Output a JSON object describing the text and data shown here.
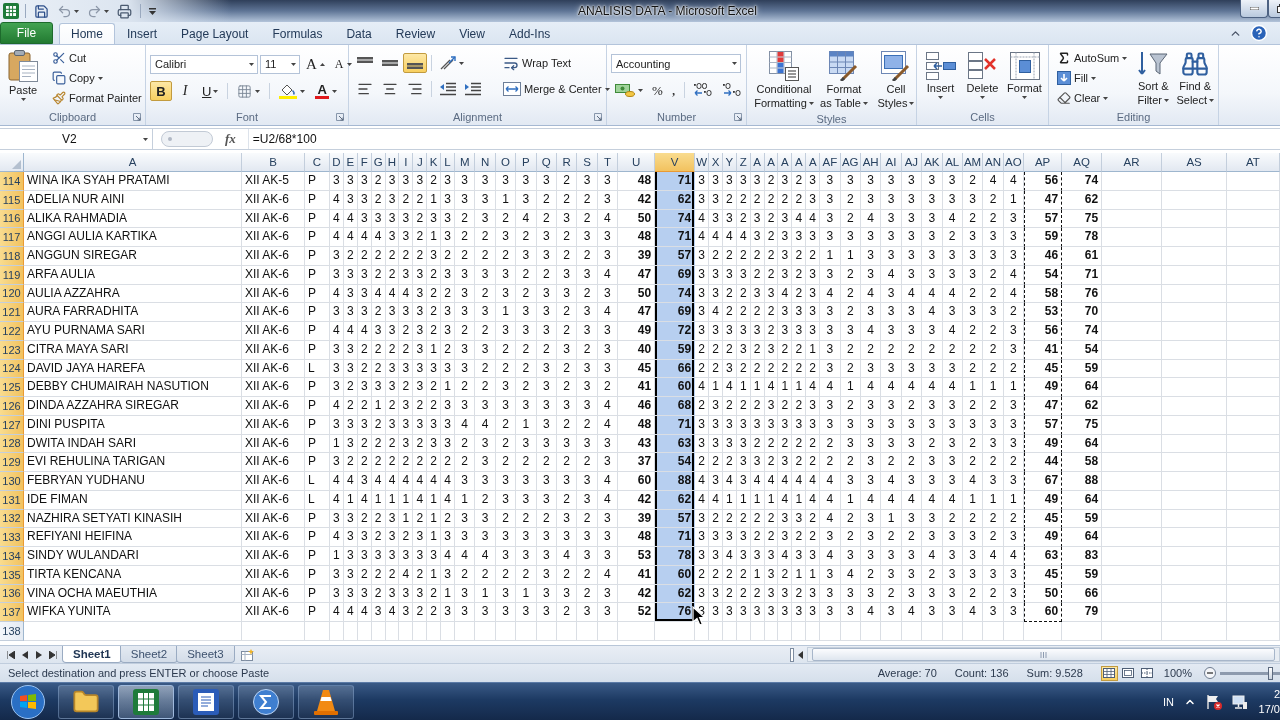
{
  "window": {
    "title": "ANALISIS DATA - Microsoft Excel"
  },
  "tabs": [
    {
      "label": "File",
      "kind": "file",
      "selected": false
    },
    {
      "label": "Home",
      "kind": "tab",
      "selected": true
    },
    {
      "label": "Insert",
      "kind": "tab",
      "selected": false
    },
    {
      "label": "Page Layout",
      "kind": "tab",
      "selected": false
    },
    {
      "label": "Formulas",
      "kind": "tab",
      "selected": false
    },
    {
      "label": "Data",
      "kind": "tab",
      "selected": false
    },
    {
      "label": "Review",
      "kind": "tab",
      "selected": false
    },
    {
      "label": "View",
      "kind": "tab",
      "selected": false
    },
    {
      "label": "Add-Ins",
      "kind": "tab",
      "selected": false
    }
  ],
  "ribbon": {
    "clipboard": {
      "label": "Clipboard",
      "paste": "Paste",
      "actions": [
        {
          "kind": "cut",
          "label": "Cut",
          "dropdown": false
        },
        {
          "kind": "copy",
          "label": "Copy",
          "dropdown": true
        },
        {
          "kind": "painter",
          "label": "Format Painter",
          "dropdown": false
        }
      ]
    },
    "font": {
      "label": "Font",
      "name": "Calibri",
      "size": "11",
      "grow": "A",
      "shrink": "A",
      "styles": [
        {
          "kind": "bold",
          "label": "B",
          "selected": true,
          "dropdown": false
        },
        {
          "kind": "italic",
          "label": "I",
          "selected": false,
          "dropdown": false
        },
        {
          "kind": "underline",
          "label": "U",
          "selected": false,
          "dropdown": true
        }
      ],
      "color_letter": "A"
    },
    "alignment": {
      "label": "Alignment",
      "vertical": [
        {
          "kind": "top",
          "selected": false
        },
        {
          "kind": "middle",
          "selected": false
        },
        {
          "kind": "bottom",
          "selected": true
        }
      ],
      "horizontal": [
        {
          "kind": "left",
          "selected": false
        },
        {
          "kind": "center",
          "selected": false
        },
        {
          "kind": "right",
          "selected": false
        }
      ],
      "wrap": "Wrap Text",
      "merge": "Merge & Center"
    },
    "number": {
      "label": "Number",
      "format": "Accounting",
      "percent": "%",
      "comma": ","
    },
    "styles": {
      "label": "Styles",
      "buttons": [
        {
          "kind": "conditional",
          "lines": [
            "Conditional",
            "Formatting"
          ]
        },
        {
          "kind": "table",
          "lines": [
            "Format",
            "as Table"
          ]
        },
        {
          "kind": "cell_styles",
          "lines": [
            "Cell",
            "Styles"
          ]
        }
      ]
    },
    "cells": {
      "label": "Cells",
      "buttons": [
        {
          "kind": "insert",
          "label": "Insert"
        },
        {
          "kind": "delete",
          "label": "Delete"
        },
        {
          "kind": "format",
          "label": "Format"
        }
      ]
    },
    "editing": {
      "label": "Editing",
      "small": [
        {
          "kind": "autosum",
          "label": "AutoSum"
        },
        {
          "kind": "fill",
          "label": "Fill"
        },
        {
          "kind": "clear",
          "label": "Clear"
        }
      ],
      "large": [
        {
          "kind": "sort",
          "lines": [
            "Sort &",
            "Filter"
          ]
        },
        {
          "kind": "find",
          "lines": [
            "Find &",
            "Select"
          ]
        }
      ]
    }
  },
  "formula_bar": {
    "name_box": "V2",
    "fx": "fx",
    "formula": "=U2/68*100"
  },
  "sheet": {
    "columns": [
      {
        "label": "A",
        "kind": "text",
        "selected": false,
        "copied": false
      },
      {
        "label": "B",
        "kind": "text",
        "selected": false,
        "copied": false
      },
      {
        "label": "C",
        "kind": "text",
        "selected": false,
        "copied": false
      },
      {
        "label": "D",
        "kind": "digit",
        "selected": false,
        "copied": false
      },
      {
        "label": "E",
        "kind": "digit",
        "selected": false,
        "copied": false
      },
      {
        "label": "F",
        "kind": "digit",
        "selected": false,
        "copied": false
      },
      {
        "label": "G",
        "kind": "digit",
        "selected": false,
        "copied": false
      },
      {
        "label": "H",
        "kind": "digit",
        "selected": false,
        "copied": false
      },
      {
        "label": "I",
        "kind": "digit",
        "selected": false,
        "copied": false
      },
      {
        "label": "J",
        "kind": "digit",
        "selected": false,
        "copied": false
      },
      {
        "label": "K",
        "kind": "digit",
        "selected": false,
        "copied": false
      },
      {
        "label": "L",
        "kind": "digit",
        "selected": false,
        "copied": false
      },
      {
        "label": "M",
        "kind": "digit",
        "selected": false,
        "copied": false
      },
      {
        "label": "N",
        "kind": "digit",
        "selected": false,
        "copied": false
      },
      {
        "label": "O",
        "kind": "digit",
        "selected": false,
        "copied": false
      },
      {
        "label": "P",
        "kind": "digit",
        "selected": false,
        "copied": false
      },
      {
        "label": "Q",
        "kind": "digit",
        "selected": false,
        "copied": false
      },
      {
        "label": "R",
        "kind": "digit",
        "selected": false,
        "copied": false
      },
      {
        "label": "S",
        "kind": "digit",
        "selected": false,
        "copied": false
      },
      {
        "label": "T",
        "kind": "digit",
        "selected": false,
        "copied": false
      },
      {
        "label": "U",
        "kind": "total",
        "selected": false,
        "copied": false
      },
      {
        "label": "V",
        "kind": "total",
        "selected": true,
        "copied": false
      },
      {
        "label": "W",
        "kind": "digit",
        "selected": false,
        "copied": false
      },
      {
        "label": "X",
        "kind": "digit",
        "selected": false,
        "copied": false
      },
      {
        "label": "Y",
        "kind": "digit",
        "selected": false,
        "copied": false
      },
      {
        "label": "Z",
        "kind": "digit",
        "selected": false,
        "copied": false
      },
      {
        "label": "A",
        "kind": "digit",
        "selected": false,
        "copied": false
      },
      {
        "label": "A",
        "kind": "digit",
        "selected": false,
        "copied": false
      },
      {
        "label": "A",
        "kind": "digit",
        "selected": false,
        "copied": false
      },
      {
        "label": "A",
        "kind": "digit",
        "selected": false,
        "copied": false
      },
      {
        "label": "A",
        "kind": "digit",
        "selected": false,
        "copied": false
      },
      {
        "label": "AF",
        "kind": "digit",
        "selected": false,
        "copied": false
      },
      {
        "label": "AG",
        "kind": "digit",
        "selected": false,
        "copied": false
      },
      {
        "label": "AH",
        "kind": "digit",
        "selected": false,
        "copied": false
      },
      {
        "label": "AI",
        "kind": "digit",
        "selected": false,
        "copied": false
      },
      {
        "label": "AJ",
        "kind": "digit",
        "selected": false,
        "copied": false
      },
      {
        "label": "AK",
        "kind": "digit",
        "selected": false,
        "copied": false
      },
      {
        "label": "AL",
        "kind": "digit",
        "selected": false,
        "copied": false
      },
      {
        "label": "AM",
        "kind": "digit",
        "selected": false,
        "copied": false
      },
      {
        "label": "AN",
        "kind": "digit",
        "selected": false,
        "copied": false
      },
      {
        "label": "AO",
        "kind": "digit",
        "selected": false,
        "copied": false
      },
      {
        "label": "AP",
        "kind": "total",
        "selected": false,
        "copied": true
      },
      {
        "label": "AQ",
        "kind": "total",
        "selected": false,
        "copied": false
      },
      {
        "label": "AR",
        "kind": "blank",
        "selected": false,
        "copied": false
      },
      {
        "label": "AS",
        "kind": "blank",
        "selected": false,
        "copied": false
      },
      {
        "label": "AT",
        "kind": "blank",
        "selected": false,
        "copied": false
      }
    ],
    "rows": [
      {
        "number": "114",
        "selected": true,
        "cells": [
          "WINA IKA SYAH PRATAMI",
          "XII AK-5",
          "P",
          "3",
          "3",
          "3",
          "2",
          "3",
          "3",
          "3",
          "2",
          "3",
          "3",
          "3",
          "3",
          "3",
          "3",
          "2",
          "3",
          "3",
          "48",
          "71",
          "3",
          "3",
          "3",
          "3",
          "3",
          "2",
          "3",
          "2",
          "3",
          "3",
          "3",
          "3",
          "3",
          "3",
          "3",
          "3",
          "2",
          "4",
          "4",
          "56",
          "74"
        ]
      },
      {
        "number": "115",
        "selected": true,
        "cells": [
          "ADELIA NUR AINI",
          "XII AK-6",
          "P",
          "4",
          "3",
          "3",
          "2",
          "3",
          "2",
          "2",
          "1",
          "3",
          "3",
          "3",
          "1",
          "3",
          "2",
          "2",
          "2",
          "3",
          "42",
          "62",
          "3",
          "3",
          "2",
          "2",
          "2",
          "2",
          "2",
          "2",
          "3",
          "3",
          "2",
          "3",
          "3",
          "3",
          "3",
          "3",
          "3",
          "2",
          "1",
          "47",
          "62"
        ]
      },
      {
        "number": "116",
        "selected": true,
        "cells": [
          "ALIKA RAHMADIA",
          "XII AK-6",
          "P",
          "4",
          "4",
          "3",
          "3",
          "3",
          "3",
          "2",
          "3",
          "3",
          "2",
          "3",
          "2",
          "4",
          "2",
          "3",
          "2",
          "4",
          "50",
          "74",
          "4",
          "3",
          "3",
          "2",
          "3",
          "2",
          "3",
          "4",
          "4",
          "3",
          "2",
          "4",
          "3",
          "3",
          "3",
          "4",
          "2",
          "2",
          "3",
          "57",
          "75"
        ]
      },
      {
        "number": "117",
        "selected": true,
        "cells": [
          "ANGGI AULIA KARTIKA",
          "XII AK-6",
          "P",
          "4",
          "4",
          "4",
          "4",
          "3",
          "3",
          "2",
          "1",
          "3",
          "2",
          "2",
          "3",
          "2",
          "3",
          "2",
          "3",
          "3",
          "48",
          "71",
          "4",
          "4",
          "4",
          "4",
          "3",
          "2",
          "3",
          "3",
          "3",
          "3",
          "3",
          "3",
          "3",
          "3",
          "3",
          "2",
          "3",
          "3",
          "3",
          "59",
          "78"
        ]
      },
      {
        "number": "118",
        "selected": true,
        "cells": [
          "ANGGUN SIREGAR",
          "XII AK-6",
          "P",
          "3",
          "2",
          "2",
          "2",
          "2",
          "2",
          "2",
          "3",
          "2",
          "2",
          "2",
          "2",
          "3",
          "3",
          "2",
          "2",
          "3",
          "39",
          "57",
          "3",
          "2",
          "2",
          "2",
          "2",
          "2",
          "3",
          "2",
          "2",
          "1",
          "1",
          "3",
          "3",
          "3",
          "3",
          "3",
          "3",
          "3",
          "3",
          "46",
          "61"
        ]
      },
      {
        "number": "119",
        "selected": true,
        "cells": [
          "ARFA AULIA",
          "XII AK-6",
          "P",
          "3",
          "3",
          "3",
          "2",
          "2",
          "3",
          "3",
          "2",
          "3",
          "3",
          "3",
          "3",
          "2",
          "2",
          "3",
          "3",
          "4",
          "47",
          "69",
          "3",
          "3",
          "3",
          "3",
          "2",
          "2",
          "3",
          "2",
          "3",
          "3",
          "2",
          "3",
          "4",
          "3",
          "3",
          "3",
          "3",
          "2",
          "4",
          "54",
          "71"
        ]
      },
      {
        "number": "120",
        "selected": true,
        "cells": [
          "AULIA AZZAHRA",
          "XII AK-6",
          "P",
          "4",
          "3",
          "3",
          "4",
          "4",
          "4",
          "3",
          "2",
          "2",
          "3",
          "2",
          "3",
          "2",
          "3",
          "3",
          "2",
          "3",
          "50",
          "74",
          "3",
          "3",
          "2",
          "2",
          "3",
          "3",
          "4",
          "2",
          "3",
          "4",
          "2",
          "4",
          "3",
          "4",
          "4",
          "4",
          "2",
          "2",
          "4",
          "58",
          "76"
        ]
      },
      {
        "number": "121",
        "selected": true,
        "cells": [
          "AURA FARRADHITA",
          "XII AK-6",
          "P",
          "3",
          "3",
          "3",
          "2",
          "3",
          "3",
          "3",
          "2",
          "3",
          "3",
          "3",
          "1",
          "3",
          "3",
          "2",
          "3",
          "4",
          "47",
          "69",
          "3",
          "4",
          "2",
          "2",
          "2",
          "2",
          "3",
          "3",
          "3",
          "3",
          "2",
          "3",
          "3",
          "3",
          "4",
          "3",
          "3",
          "3",
          "2",
          "53",
          "70"
        ]
      },
      {
        "number": "122",
        "selected": true,
        "cells": [
          "AYU PURNAMA SARI",
          "XII AK-6",
          "P",
          "4",
          "4",
          "4",
          "3",
          "3",
          "2",
          "3",
          "2",
          "3",
          "2",
          "2",
          "3",
          "3",
          "3",
          "2",
          "3",
          "3",
          "49",
          "72",
          "3",
          "3",
          "3",
          "3",
          "3",
          "2",
          "3",
          "3",
          "3",
          "3",
          "3",
          "4",
          "3",
          "3",
          "3",
          "4",
          "2",
          "2",
          "3",
          "56",
          "74"
        ]
      },
      {
        "number": "123",
        "selected": true,
        "cells": [
          "CITRA MAYA SARI",
          "XII AK-6",
          "P",
          "3",
          "3",
          "2",
          "2",
          "2",
          "2",
          "3",
          "1",
          "2",
          "3",
          "3",
          "2",
          "2",
          "2",
          "3",
          "2",
          "3",
          "40",
          "59",
          "2",
          "2",
          "2",
          "3",
          "2",
          "3",
          "2",
          "2",
          "1",
          "3",
          "2",
          "2",
          "2",
          "2",
          "2",
          "2",
          "2",
          "2",
          "3",
          "41",
          "54"
        ]
      },
      {
        "number": "124",
        "selected": true,
        "cells": [
          "DAVID JAYA HAREFA",
          "XII AK-6",
          "L",
          "3",
          "3",
          "2",
          "2",
          "3",
          "3",
          "3",
          "3",
          "3",
          "3",
          "2",
          "2",
          "2",
          "3",
          "2",
          "3",
          "3",
          "45",
          "66",
          "2",
          "2",
          "3",
          "2",
          "2",
          "2",
          "2",
          "2",
          "2",
          "3",
          "2",
          "3",
          "3",
          "3",
          "3",
          "3",
          "2",
          "2",
          "2",
          "45",
          "59"
        ]
      },
      {
        "number": "125",
        "selected": true,
        "cells": [
          "DEBBY CHUMAIRAH NASUTION",
          "XII AK-6",
          "P",
          "3",
          "2",
          "3",
          "3",
          "3",
          "2",
          "3",
          "2",
          "1",
          "2",
          "2",
          "3",
          "2",
          "3",
          "2",
          "3",
          "2",
          "41",
          "60",
          "4",
          "1",
          "4",
          "1",
          "1",
          "4",
          "1",
          "1",
          "4",
          "4",
          "1",
          "4",
          "4",
          "4",
          "4",
          "4",
          "1",
          "1",
          "1",
          "49",
          "64"
        ]
      },
      {
        "number": "126",
        "selected": true,
        "cells": [
          "DINDA AZZAHRA SIREGAR",
          "XII AK-6",
          "P",
          "4",
          "2",
          "2",
          "1",
          "2",
          "3",
          "2",
          "2",
          "3",
          "3",
          "3",
          "3",
          "3",
          "3",
          "3",
          "3",
          "4",
          "46",
          "68",
          "2",
          "3",
          "2",
          "2",
          "2",
          "3",
          "2",
          "2",
          "3",
          "3",
          "2",
          "3",
          "3",
          "2",
          "3",
          "3",
          "2",
          "2",
          "3",
          "47",
          "62"
        ]
      },
      {
        "number": "127",
        "selected": true,
        "cells": [
          "DINI PUSPITA",
          "XII AK-6",
          "P",
          "3",
          "3",
          "3",
          "2",
          "3",
          "3",
          "3",
          "3",
          "3",
          "4",
          "4",
          "2",
          "1",
          "3",
          "2",
          "2",
          "4",
          "48",
          "71",
          "3",
          "3",
          "3",
          "3",
          "3",
          "3",
          "3",
          "3",
          "3",
          "3",
          "3",
          "3",
          "3",
          "3",
          "3",
          "3",
          "3",
          "3",
          "3",
          "57",
          "75"
        ]
      },
      {
        "number": "128",
        "selected": true,
        "cells": [
          "DWITA INDAH SARI",
          "XII AK-6",
          "P",
          "1",
          "3",
          "2",
          "2",
          "2",
          "3",
          "2",
          "3",
          "3",
          "2",
          "3",
          "2",
          "3",
          "3",
          "3",
          "3",
          "3",
          "43",
          "63",
          "3",
          "3",
          "3",
          "3",
          "2",
          "2",
          "2",
          "2",
          "2",
          "2",
          "3",
          "3",
          "3",
          "3",
          "2",
          "3",
          "2",
          "3",
          "3",
          "49",
          "64"
        ]
      },
      {
        "number": "129",
        "selected": true,
        "cells": [
          "EVI REHULINA TARIGAN",
          "XII AK-6",
          "P",
          "3",
          "2",
          "2",
          "2",
          "2",
          "2",
          "2",
          "2",
          "2",
          "2",
          "3",
          "2",
          "2",
          "2",
          "2",
          "2",
          "3",
          "37",
          "54",
          "2",
          "2",
          "2",
          "3",
          "3",
          "2",
          "3",
          "2",
          "2",
          "2",
          "2",
          "3",
          "2",
          "2",
          "3",
          "3",
          "2",
          "2",
          "2",
          "44",
          "58"
        ]
      },
      {
        "number": "130",
        "selected": true,
        "cells": [
          "FEBRYAN YUDHANU",
          "XII AK-6",
          "L",
          "4",
          "4",
          "3",
          "4",
          "4",
          "4",
          "4",
          "4",
          "4",
          "3",
          "3",
          "3",
          "3",
          "3",
          "3",
          "3",
          "4",
          "60",
          "88",
          "4",
          "3",
          "4",
          "3",
          "4",
          "4",
          "4",
          "4",
          "4",
          "4",
          "3",
          "3",
          "4",
          "3",
          "3",
          "3",
          "4",
          "3",
          "3",
          "67",
          "88"
        ]
      },
      {
        "number": "131",
        "selected": true,
        "cells": [
          "IDE FIMAN",
          "XII AK-6",
          "L",
          "4",
          "1",
          "4",
          "1",
          "1",
          "1",
          "4",
          "1",
          "4",
          "1",
          "2",
          "3",
          "3",
          "3",
          "2",
          "3",
          "4",
          "42",
          "62",
          "4",
          "4",
          "1",
          "1",
          "1",
          "1",
          "4",
          "1",
          "4",
          "4",
          "1",
          "4",
          "4",
          "4",
          "4",
          "4",
          "1",
          "1",
          "1",
          "49",
          "64"
        ]
      },
      {
        "number": "132",
        "selected": true,
        "cells": [
          "NAZHIRA SETYATI KINASIH",
          "XII AK-6",
          "P",
          "3",
          "3",
          "2",
          "2",
          "3",
          "1",
          "2",
          "1",
          "2",
          "3",
          "3",
          "2",
          "2",
          "2",
          "3",
          "2",
          "3",
          "39",
          "57",
          "3",
          "2",
          "2",
          "2",
          "2",
          "2",
          "3",
          "3",
          "2",
          "4",
          "2",
          "3",
          "1",
          "3",
          "3",
          "2",
          "2",
          "2",
          "2",
          "45",
          "59"
        ]
      },
      {
        "number": "133",
        "selected": true,
        "cells": [
          "REFIYANI HEIFINA",
          "XII AK-6",
          "P",
          "4",
          "3",
          "3",
          "2",
          "3",
          "2",
          "3",
          "1",
          "3",
          "3",
          "3",
          "3",
          "3",
          "3",
          "3",
          "3",
          "3",
          "48",
          "71",
          "3",
          "3",
          "3",
          "3",
          "2",
          "2",
          "3",
          "2",
          "2",
          "3",
          "2",
          "3",
          "2",
          "2",
          "3",
          "3",
          "3",
          "2",
          "3",
          "49",
          "64"
        ]
      },
      {
        "number": "134",
        "selected": true,
        "cells": [
          "SINDY WULANDARI",
          "XII AK-6",
          "P",
          "1",
          "3",
          "3",
          "3",
          "3",
          "3",
          "3",
          "3",
          "4",
          "4",
          "4",
          "3",
          "3",
          "3",
          "4",
          "3",
          "3",
          "53",
          "78",
          "3",
          "3",
          "4",
          "3",
          "3",
          "3",
          "4",
          "3",
          "3",
          "4",
          "3",
          "3",
          "3",
          "3",
          "4",
          "3",
          "3",
          "4",
          "4",
          "63",
          "83"
        ]
      },
      {
        "number": "135",
        "selected": true,
        "cells": [
          "TIRTA KENCANA",
          "XII AK-6",
          "P",
          "3",
          "3",
          "2",
          "2",
          "2",
          "4",
          "2",
          "1",
          "3",
          "2",
          "2",
          "2",
          "2",
          "3",
          "2",
          "2",
          "4",
          "41",
          "60",
          "2",
          "2",
          "2",
          "2",
          "1",
          "3",
          "2",
          "1",
          "1",
          "3",
          "4",
          "2",
          "3",
          "3",
          "2",
          "3",
          "3",
          "3",
          "3",
          "45",
          "59"
        ]
      },
      {
        "number": "136",
        "selected": true,
        "cells": [
          "VINA OCHA MAEUTHIA",
          "XII AK-6",
          "P",
          "3",
          "3",
          "3",
          "2",
          "3",
          "3",
          "3",
          "2",
          "1",
          "3",
          "1",
          "3",
          "1",
          "3",
          "3",
          "2",
          "3",
          "42",
          "62",
          "3",
          "3",
          "2",
          "2",
          "2",
          "3",
          "3",
          "2",
          "3",
          "3",
          "3",
          "3",
          "2",
          "3",
          "3",
          "3",
          "2",
          "2",
          "3",
          "50",
          "66"
        ]
      },
      {
        "number": "137",
        "selected": true,
        "cells": [
          "WIFKA YUNITA",
          "XII AK-6",
          "P",
          "4",
          "4",
          "4",
          "3",
          "4",
          "3",
          "2",
          "2",
          "3",
          "3",
          "3",
          "3",
          "3",
          "3",
          "2",
          "3",
          "3",
          "52",
          "76",
          "3",
          "3",
          "3",
          "3",
          "3",
          "3",
          "3",
          "3",
          "3",
          "3",
          "3",
          "4",
          "3",
          "4",
          "3",
          "3",
          "4",
          "3",
          "3",
          "60",
          "79"
        ]
      },
      {
        "number": "138",
        "selected": false
      }
    ]
  },
  "sheet_tabs": [
    {
      "label": "Sheet1",
      "selected": true
    },
    {
      "label": "Sheet2",
      "selected": false
    },
    {
      "label": "Sheet3",
      "selected": false
    }
  ],
  "status_bar": {
    "message": "Select destination and press ENTER or choose Paste",
    "average": "Average: 70",
    "count": "Count: 136",
    "sum": "Sum: 9.528",
    "views": [
      {
        "kind": "normal",
        "selected": true
      },
      {
        "kind": "page_layout",
        "selected": false
      },
      {
        "kind": "page_break",
        "selected": false
      }
    ],
    "zoom": "100%",
    "zoom_slider": {
      "level": 0.5
    }
  },
  "taskbar": {
    "apps": [
      {
        "kind": "explorer",
        "selected": false
      },
      {
        "kind": "excel",
        "selected": true
      },
      {
        "kind": "word",
        "selected": false
      },
      {
        "kind": "math",
        "selected": false
      },
      {
        "kind": "vlc",
        "selected": false
      }
    ],
    "language": "IN",
    "time": "2",
    "date": "17/0"
  }
}
